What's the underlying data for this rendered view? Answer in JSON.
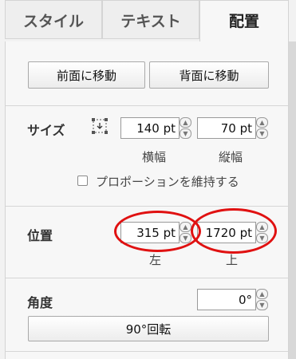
{
  "tabs": [
    {
      "label": "スタイル"
    },
    {
      "label": "テキスト"
    },
    {
      "label": "配置"
    }
  ],
  "arrange": {
    "bring_front": "前面に移動",
    "send_back": "背面に移動"
  },
  "size": {
    "label": "サイズ",
    "width_value": "140 pt",
    "height_value": "70 pt",
    "width_label": "横幅",
    "height_label": "縦幅",
    "keep_proportions_label": "プロポーションを維持する",
    "keep_proportions_checked": false
  },
  "position": {
    "label": "位置",
    "left_value": "315 pt",
    "top_value": "1720 pt",
    "left_label": "左",
    "top_label": "上"
  },
  "angle": {
    "label": "角度",
    "value": "0°",
    "rotate_button": "90°回転"
  },
  "colors": {
    "annotation": "#e01111"
  }
}
